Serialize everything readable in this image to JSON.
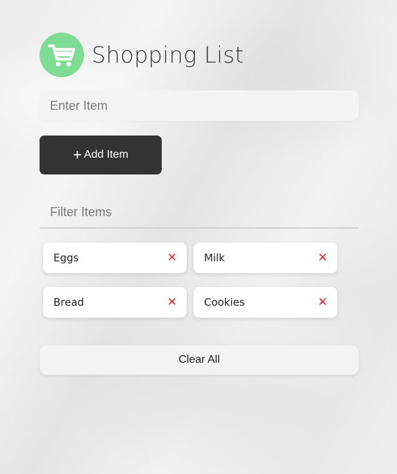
{
  "header": {
    "title": "Shopping List",
    "logo_icon": "shopping-cart-icon",
    "logo_color": "#7fdc94"
  },
  "item_input": {
    "placeholder": "Enter Item",
    "value": ""
  },
  "add_button": {
    "icon": "plus-icon",
    "icon_glyph": "+",
    "label": "Add Item",
    "color": "#333333"
  },
  "filter_input": {
    "placeholder": "Filter Items",
    "value": ""
  },
  "items": [
    {
      "label": "Eggs",
      "remove_icon": "✕"
    },
    {
      "label": "Milk",
      "remove_icon": "✕"
    },
    {
      "label": "Bread",
      "remove_icon": "✕"
    },
    {
      "label": "Cookies",
      "remove_icon": "✕"
    }
  ],
  "remove_color": "#e0242b",
  "clear_button": {
    "label": "Clear All"
  }
}
